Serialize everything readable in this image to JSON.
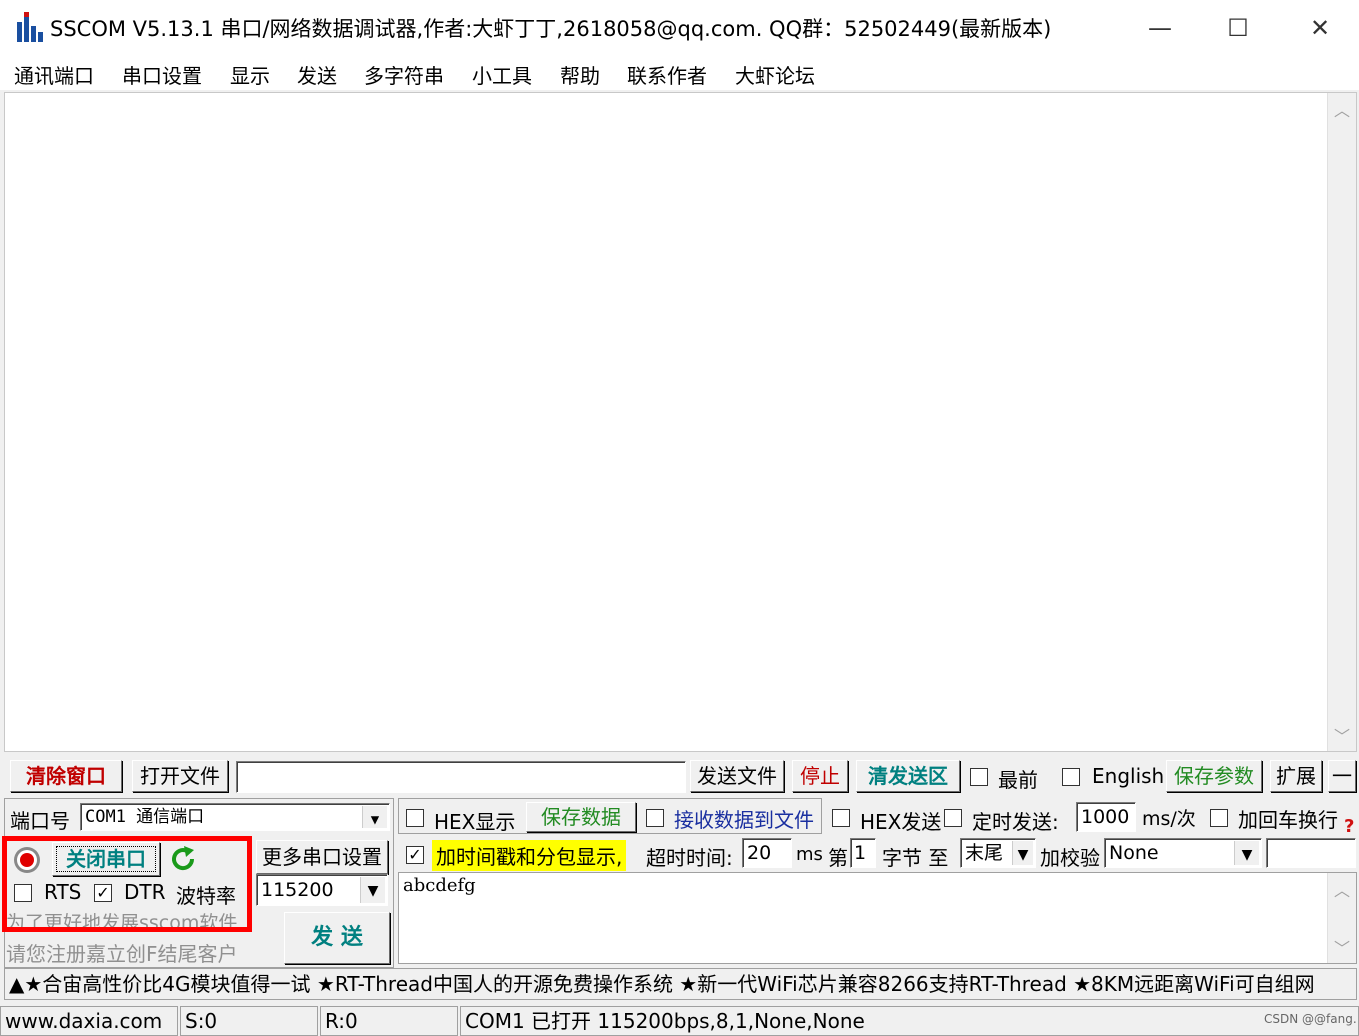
{
  "window": {
    "title": "SSCOM V5.13.1 串口/网络数据调试器,作者:大虾丁丁,2618058@qq.com. QQ群：52502449(最新版本)",
    "minimize": "—",
    "maximize": "☐",
    "close": "✕"
  },
  "menu": [
    "通讯端口",
    "串口设置",
    "显示",
    "发送",
    "多字符串",
    "小工具",
    "帮助",
    "联系作者",
    "大虾论坛"
  ],
  "toolbar": {
    "clear_window": "清除窗口",
    "open_file": "打开文件",
    "file_path": "",
    "send_file": "发送文件",
    "stop": "停止",
    "clear_send": "清发送区",
    "topmost": "最前",
    "english": "English",
    "save_params": "保存参数",
    "expand": "扩展",
    "collapse": "一"
  },
  "serial": {
    "port_label": "端口号",
    "port_value": "COM1  通信端口",
    "close_port": "关闭串口",
    "more_settings": "更多串口设置",
    "rts": "RTS",
    "dtr": "DTR",
    "baud_label": "波特率",
    "baud_value": "115200",
    "promo1": "为了更好地发展sscom软件",
    "promo2": "请您注册嘉立创F结尾客户",
    "send_button": "发  送"
  },
  "options": {
    "hex_display": "HEX显示",
    "save_data": "保存数据",
    "receive_to_file": "接收数据到文件",
    "hex_send": "HEX发送",
    "timed_send": "定时发送:",
    "interval_value": "1000",
    "interval_unit": "ms/次",
    "append_crlf": "加回车换行",
    "timestamp": "加时间戳和分包显示,",
    "timeout_label": "超时时间:",
    "timeout_value": "20",
    "timeout_unit": "ms",
    "byte_prefix": "第",
    "byte_value": "1",
    "byte_label": "字节 至",
    "end_value": "末尾",
    "checksum_label": "加校验",
    "checksum_value": "None"
  },
  "send_area": {
    "text": "abcdefg"
  },
  "ticker": "▲★合宙高性价比4G模块值得一试 ★RT-Thread中国人的开源免费操作系统 ★新一代WiFi芯片兼容8266支持RT-Thread ★8KM远距离WiFi可自组网",
  "statusbar": {
    "website": "www.daxia.com",
    "sent": "S:0",
    "received": "R:0",
    "port_status": "COM1 已打开  115200bps,8,1,None,None"
  },
  "watermark": "CSDN @@fang.",
  "colors": {
    "highlight_box": "#ff0000",
    "clear_window_text": "#c00000",
    "stop_text": "#c00000",
    "clear_send_text": "#008080",
    "save_text": "#228b22",
    "timestamp_bg": "#ffff00",
    "promo_text": "#909090"
  }
}
